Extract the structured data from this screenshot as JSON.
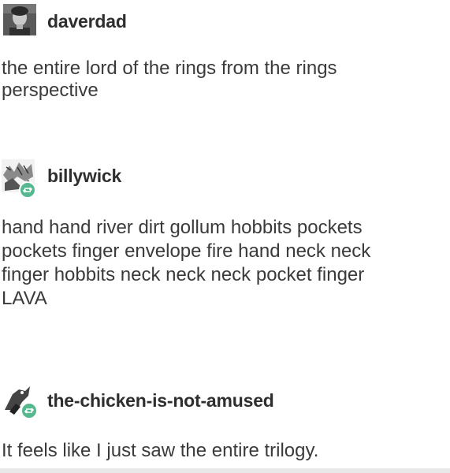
{
  "posts": [
    {
      "username": "daverdad",
      "avatar_icon": "person-photo-icon",
      "reblog": false,
      "lines": [
        "the entire lord of the rings from the rings",
        "perspective"
      ]
    },
    {
      "username": "billywick",
      "avatar_icon": "sketch-photo-icon",
      "reblog": true,
      "lines": [
        "hand hand river dirt gollum hobbits pockets",
        "pockets finger envelope fire hand neck neck",
        "finger hobbits neck neck neck pocket finger",
        "LAVA"
      ]
    },
    {
      "username": "the-chicken-is-not-amused",
      "avatar_icon": "chicken-photo-icon",
      "reblog": true,
      "lines": [
        "It feels like I just saw the entire trilogy."
      ]
    }
  ],
  "colors": {
    "reblog_badge": "#56b88f",
    "text": "#3a3a3a"
  }
}
